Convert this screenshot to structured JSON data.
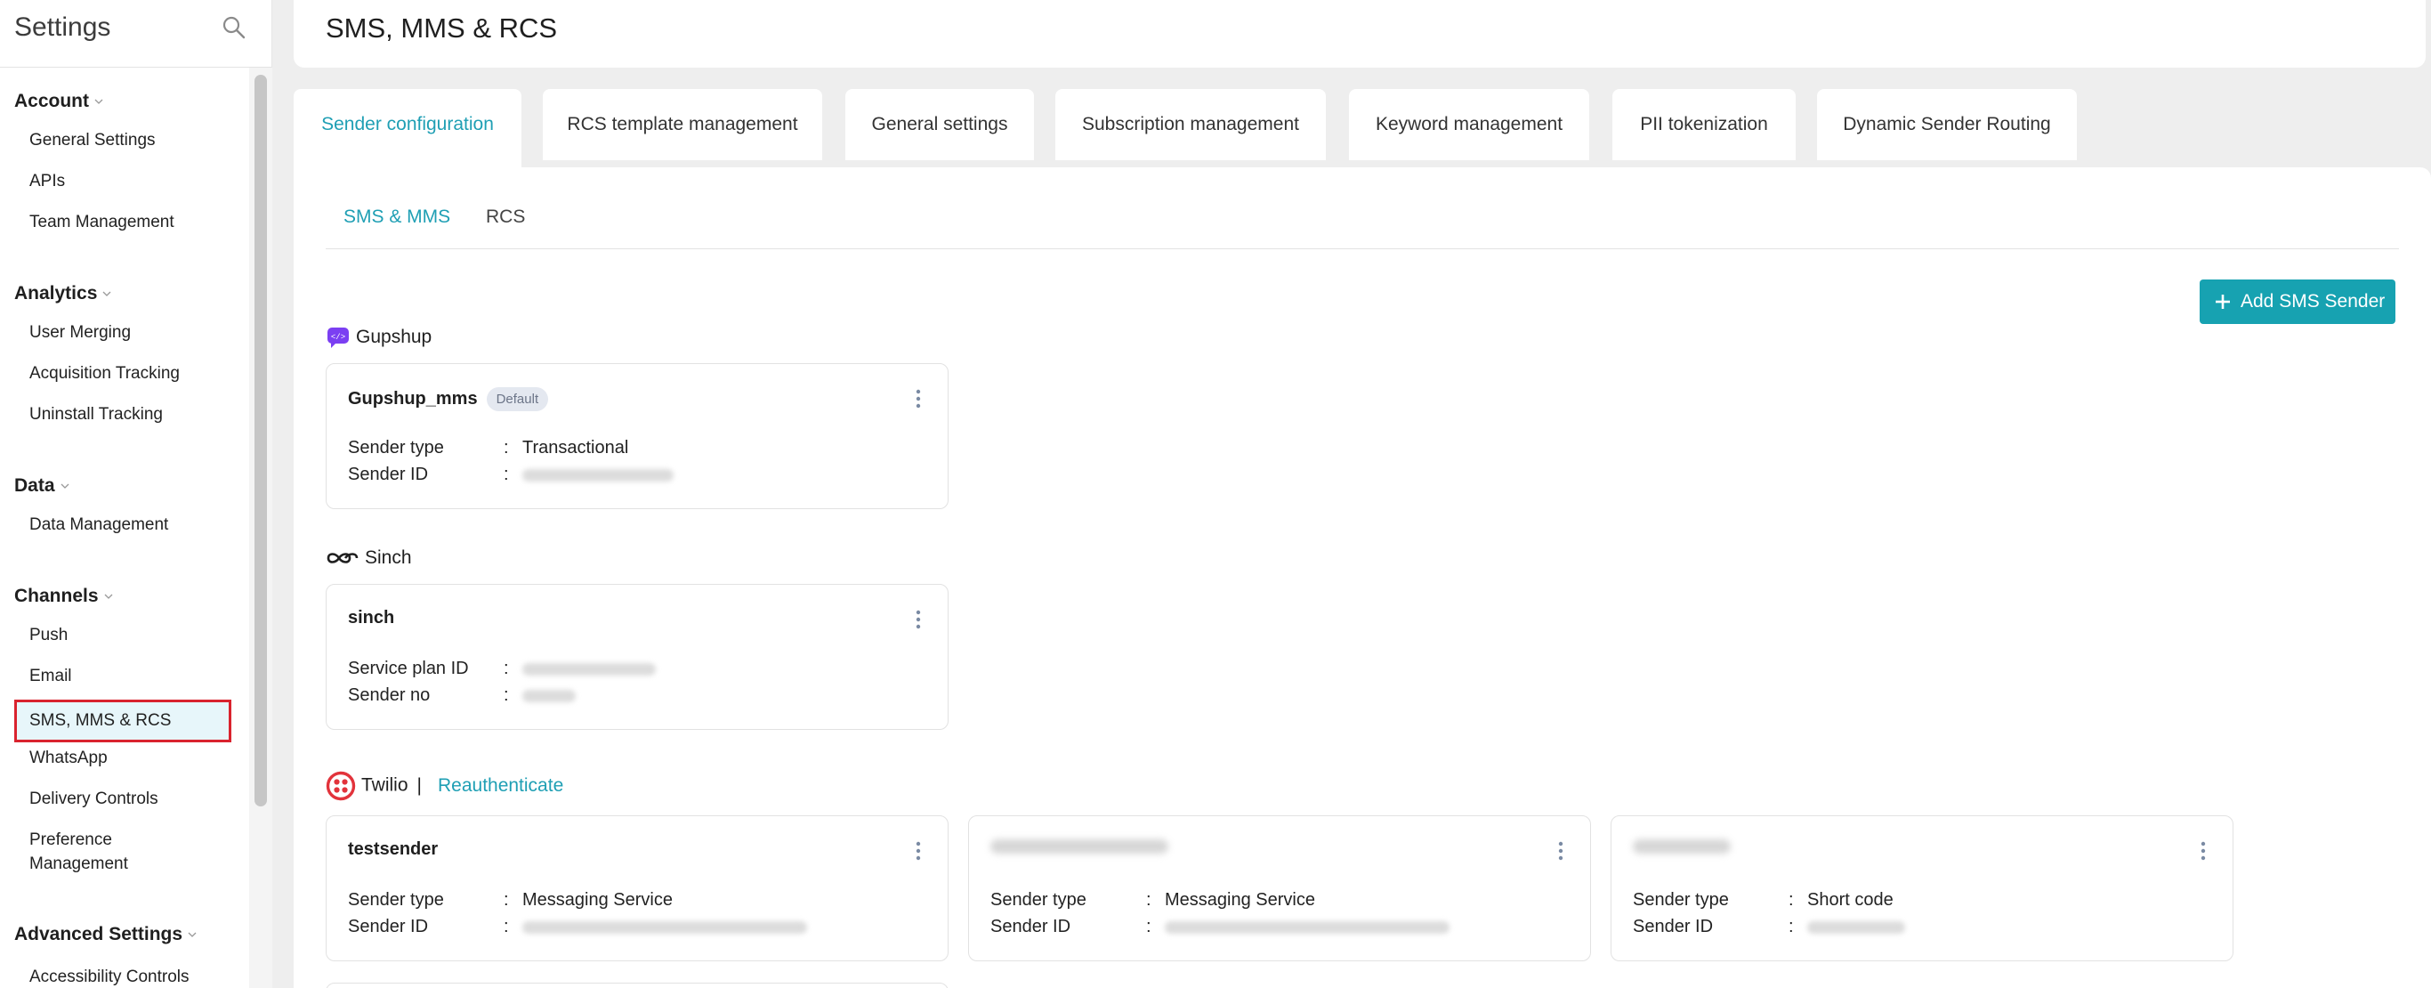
{
  "sidebar": {
    "title": "Settings",
    "sections": [
      {
        "title": "Account",
        "items": [
          "General Settings",
          "APIs",
          "Team Management"
        ]
      },
      {
        "title": "Analytics",
        "items": [
          "User Merging",
          "Acquisition Tracking",
          "Uninstall Tracking"
        ]
      },
      {
        "title": "Data",
        "items": [
          "Data Management"
        ]
      },
      {
        "title": "Channels",
        "items": [
          "Push",
          "Email",
          "SMS, MMS & RCS",
          "WhatsApp",
          "Delivery Controls",
          "Preference Management"
        ]
      },
      {
        "title": "Advanced Settings",
        "items": [
          "Accessibility Controls"
        ]
      }
    ],
    "active_item": "SMS, MMS & RCS"
  },
  "header": {
    "title": "SMS, MMS & RCS"
  },
  "tabs": [
    "Sender configuration",
    "RCS template management",
    "General settings",
    "Subscription management",
    "Keyword management",
    "PII tokenization",
    "Dynamic Sender Routing"
  ],
  "active_tab": "Sender configuration",
  "subtabs": [
    "SMS & MMS",
    "RCS"
  ],
  "active_subtab": "SMS & MMS",
  "add_button": "Add SMS Sender",
  "providers": [
    {
      "name": "Gupshup",
      "cards": [
        {
          "name": "Gupshup_mms",
          "badge": "Default",
          "rows": [
            {
              "label": "Sender type",
              "value": "Transactional"
            },
            {
              "label": "Sender ID",
              "value": ""
            }
          ]
        }
      ]
    },
    {
      "name": "Sinch",
      "cards": [
        {
          "name": "sinch",
          "rows": [
            {
              "label": "Service plan ID",
              "value": ""
            },
            {
              "label": "Sender no",
              "value": ""
            }
          ]
        }
      ]
    },
    {
      "name": "Twilio",
      "separator": "|",
      "reauth_label": "Reauthenticate",
      "cards": [
        {
          "name": "testsender",
          "rows": [
            {
              "label": "Sender type",
              "value": "Messaging Service"
            },
            {
              "label": "Sender ID",
              "value": ""
            }
          ]
        },
        {
          "name": "",
          "rows": [
            {
              "label": "Sender type",
              "value": "Messaging Service"
            },
            {
              "label": "Sender ID",
              "value": ""
            }
          ]
        },
        {
          "name": "",
          "rows": [
            {
              "label": "Sender type",
              "value": "Short code"
            },
            {
              "label": "Sender ID",
              "value": ""
            }
          ]
        }
      ]
    }
  ],
  "colors": {
    "accent": "#17a2b1",
    "accent_text": "#1f9fb4",
    "highlight_border": "#d9232e",
    "twilio": "#e2333b",
    "gupshup": "#7b3ff2"
  }
}
